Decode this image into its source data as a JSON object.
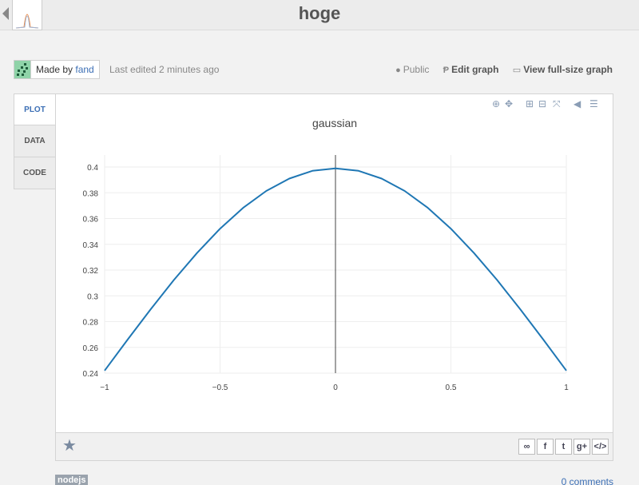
{
  "header": {
    "title": "hoge"
  },
  "meta": {
    "made_by_prefix": "Made by",
    "author": "fand",
    "last_edited": "Last edited 2 minutes ago",
    "public_label": "Public",
    "edit_label": "Edit graph",
    "view_label": "View full-size graph"
  },
  "tabs": [
    {
      "label": "PLOT",
      "active": true
    },
    {
      "label": "DATA",
      "active": false
    },
    {
      "label": "CODE",
      "active": false
    }
  ],
  "colors": {
    "line": "#1f77b4",
    "accent": "#3c6fb5",
    "avatar": "#8fd3a8"
  },
  "chart_data": {
    "type": "line",
    "title": "gaussian",
    "xlabel": "",
    "ylabel": "",
    "xlim": [
      -1,
      1
    ],
    "ylim": [
      0.24,
      0.4
    ],
    "x_ticks": [
      -1,
      -0.5,
      0,
      0.5,
      1
    ],
    "x_tick_labels": [
      "−1",
      "−0.5",
      "0",
      "0.5",
      "1"
    ],
    "y_ticks": [
      0.24,
      0.26,
      0.28,
      0.3,
      0.32,
      0.34,
      0.36,
      0.38,
      0.4
    ],
    "y_tick_labels": [
      "0.24",
      "0.26",
      "0.28",
      "0.3",
      "0.32",
      "0.34",
      "0.36",
      "0.38",
      "0.4"
    ],
    "grid": true,
    "series": [
      {
        "x": [
          -1,
          -0.9,
          -0.8,
          -0.7,
          -0.6,
          -0.5,
          -0.4,
          -0.3,
          -0.2,
          -0.1,
          0,
          0.1,
          0.2,
          0.3,
          0.4,
          0.5,
          0.6,
          0.7,
          0.8,
          0.9,
          1
        ],
        "y": [
          0.242,
          0.2661,
          0.2897,
          0.3123,
          0.3332,
          0.3521,
          0.3683,
          0.3814,
          0.391,
          0.397,
          0.3989,
          0.397,
          0.391,
          0.3814,
          0.3683,
          0.3521,
          0.3332,
          0.3123,
          0.2897,
          0.2661,
          0.242
        ]
      }
    ]
  },
  "footer": {
    "share_buttons": [
      {
        "icon": "link-icon",
        "glyph": "∞"
      },
      {
        "icon": "facebook-icon",
        "glyph": "f"
      },
      {
        "icon": "twitter-icon",
        "glyph": "t"
      },
      {
        "icon": "google-plus-icon",
        "glyph": "g+"
      },
      {
        "icon": "embed-code-icon",
        "glyph": "</>"
      }
    ]
  },
  "tag": "nodejs",
  "comments": "0 comments"
}
